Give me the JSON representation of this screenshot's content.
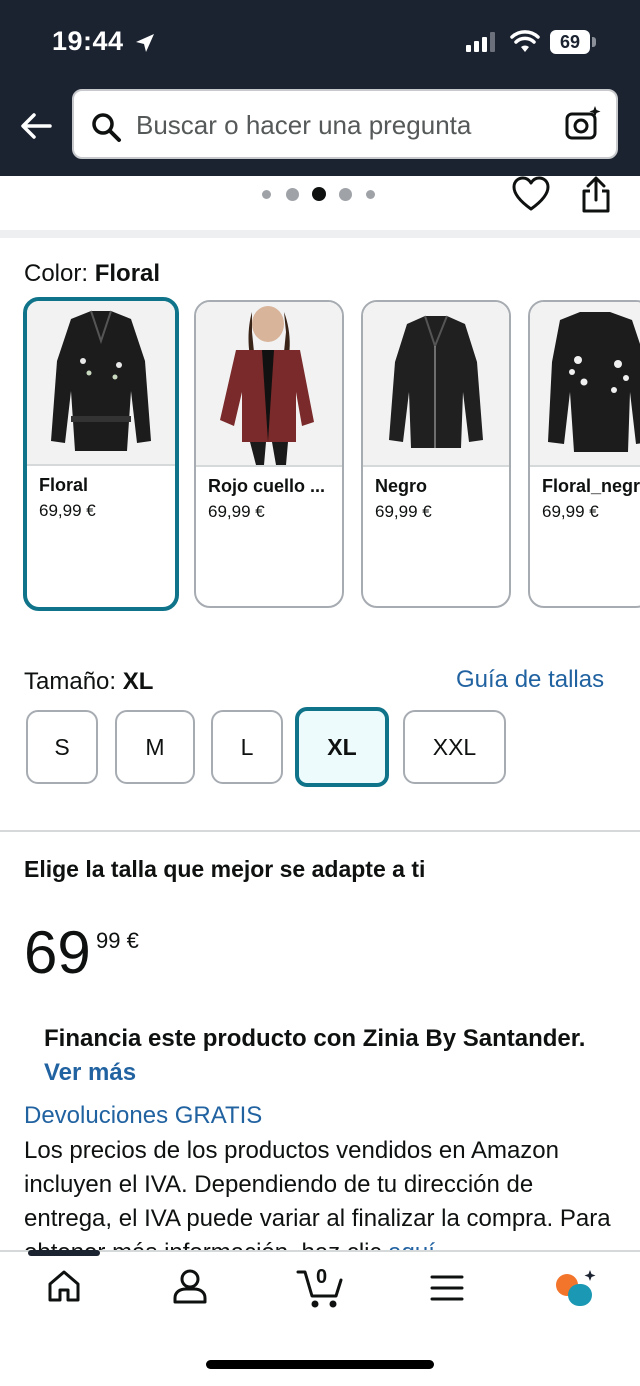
{
  "status_bar": {
    "time": "19:44",
    "battery": "69"
  },
  "search": {
    "placeholder": "Buscar o hacer una pregunta"
  },
  "color": {
    "label": "Color:",
    "selected": "Floral",
    "options": [
      {
        "name": "Floral",
        "price": "69,99 €"
      },
      {
        "name": "Rojo cuello ...",
        "price": "69,99 €"
      },
      {
        "name": "Negro",
        "price": "69,99 €"
      },
      {
        "name": "Floral_negr",
        "price": "69,99 €"
      }
    ]
  },
  "size": {
    "label": "Tamaño:",
    "selected": "XL",
    "guide_link": "Guía de tallas",
    "options": [
      "S",
      "M",
      "L",
      "XL",
      "XXL"
    ]
  },
  "fit_heading": "Elige la talla que mejor se adapte a ti",
  "price": {
    "whole": "69",
    "fraction": "99 €"
  },
  "finance": {
    "text": "Financia este producto con Zinia By Santander.",
    "link": "Ver más"
  },
  "returns": "Devoluciones GRATIS",
  "tax_note": "Los precios de los productos vendidos en Amazon incluyen el IVA. Dependiendo de tu dirección de entrega, el IVA puede variar al finalizar la compra. Para obtener más información, haz clic",
  "tax_link": "aquí",
  "cart": {
    "count": "0"
  },
  "colors": {
    "topbar": "#1b2230",
    "accent": "#0f7389",
    "link": "#2162a1",
    "assistant_orange": "#f3742b",
    "assistant_teal": "#1a98b4"
  }
}
